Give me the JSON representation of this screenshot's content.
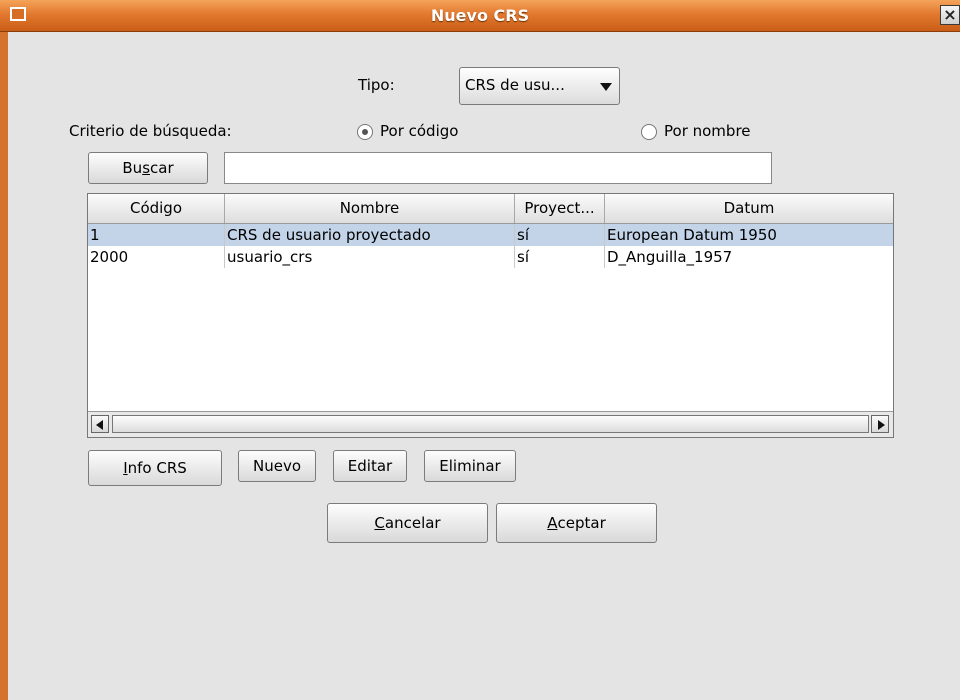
{
  "window": {
    "title": "Nuevo CRS",
    "close_glyph": "×"
  },
  "tipo": {
    "label": "Tipo:",
    "selected": "CRS de usu..."
  },
  "criterio": {
    "label": "Criterio de búsqueda:",
    "options": [
      {
        "label": "Por código",
        "selected": true
      },
      {
        "label": "Por nombre",
        "selected": false
      }
    ]
  },
  "search": {
    "button_pre": "Bu",
    "button_mnemonic": "s",
    "button_post": "car",
    "value": ""
  },
  "table": {
    "columns": [
      "Código",
      "Nombre",
      "Proyect...",
      "Datum"
    ],
    "rows": [
      [
        "1",
        "CRS de usuario proyectado",
        "sí",
        "European Datum 1950"
      ],
      [
        "2000",
        "usuario_crs",
        "sí",
        "D_Anguilla_1957"
      ]
    ],
    "selected_row": 0
  },
  "actions": {
    "info_mnemonic": "I",
    "info_rest": "nfo CRS",
    "nuevo": "Nuevo",
    "editar": "Editar",
    "eliminar": "Eliminar"
  },
  "dialog": {
    "cancel_mnemonic": "C",
    "cancel_rest": "ancelar",
    "accept_mnemonic": "A",
    "accept_rest": "ceptar"
  },
  "colors": {
    "titlebar": "#e3792f",
    "selection": "#c3d3e8",
    "background": "#e4e4e4"
  }
}
